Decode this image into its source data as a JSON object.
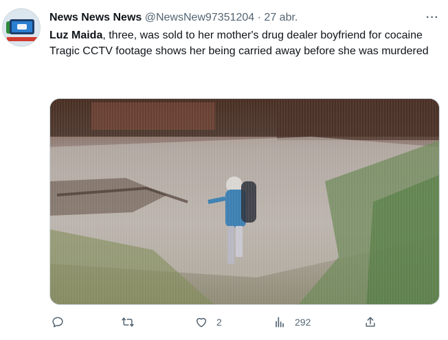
{
  "tweet": {
    "display_name": "News News News",
    "handle": "@NewsNew97351204",
    "separator": "·",
    "time": "27 abr.",
    "text_bold": "Luz Maida",
    "text_line1_rest": ", three, was sold to her mother's drug dealer boyfriend for cocaine",
    "text_line2": "Tragic CCTV footage shows her being carried away before she was murdered"
  },
  "actions": {
    "reply_icon": "reply-icon",
    "retweet_icon": "retweet-icon",
    "like_icon": "heart-icon",
    "like_count": "2",
    "views_icon": "views-icon",
    "views_count": "292",
    "share_icon": "share-icon"
  },
  "colors": {
    "text": "#0f1419",
    "secondary": "#536471",
    "border": "#cfd9de"
  }
}
